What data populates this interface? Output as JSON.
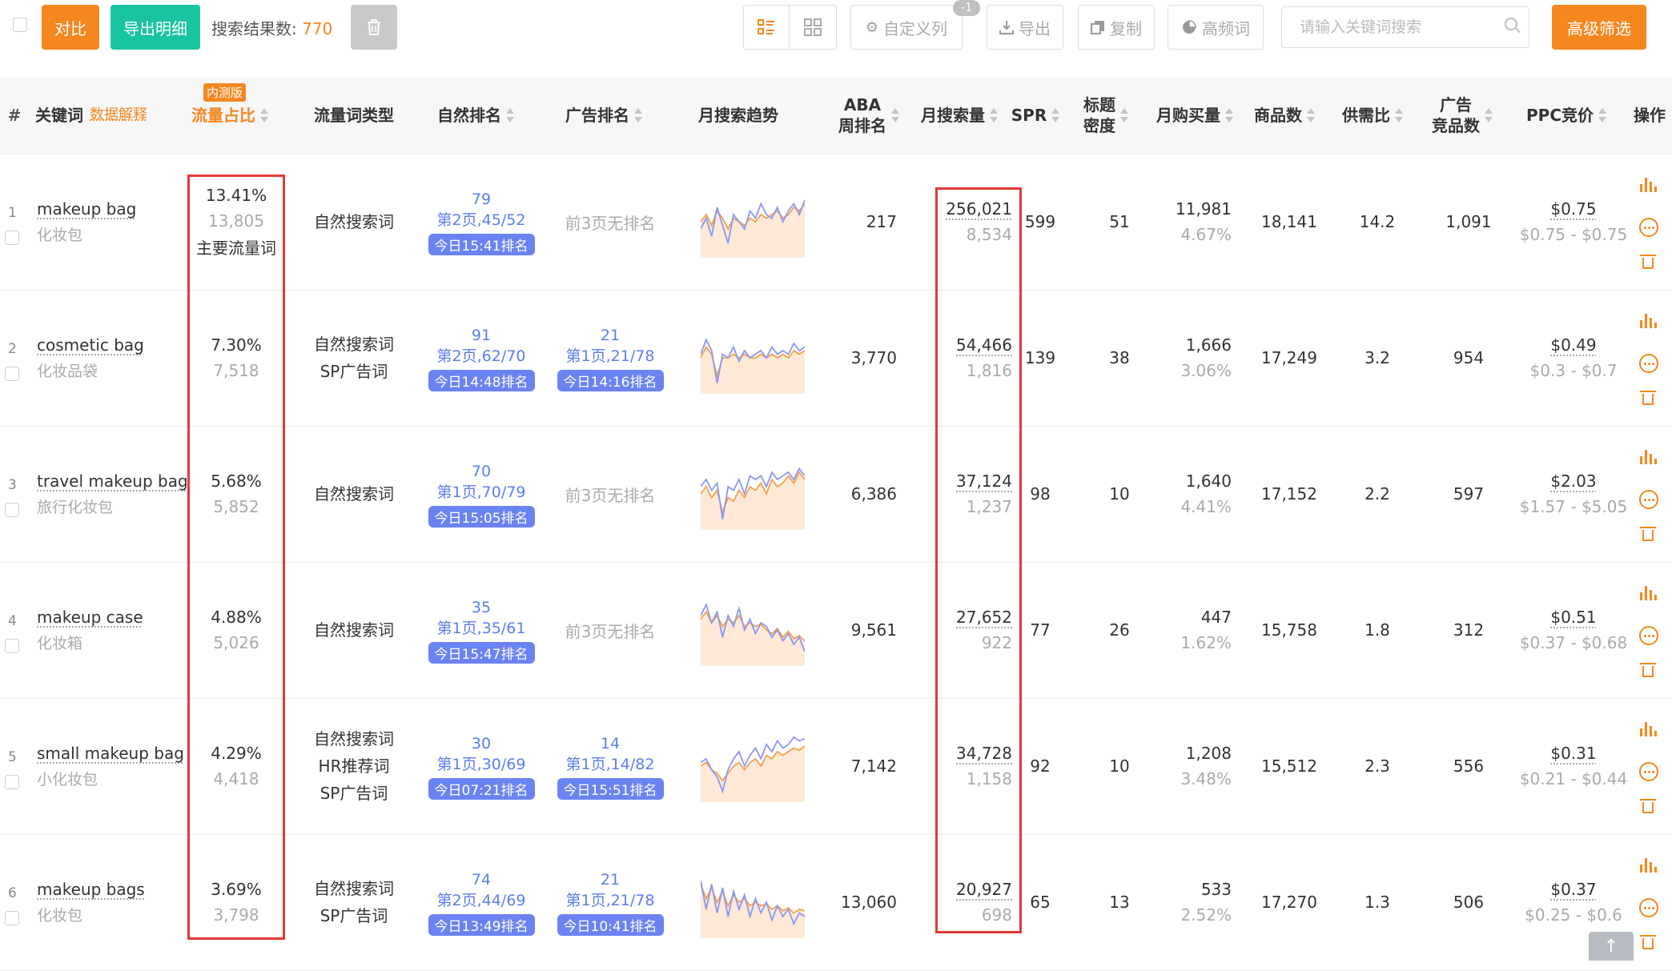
{
  "toolbar": {
    "compare_label": "对比",
    "export_detail_label": "导出明细",
    "result_label": "搜索结果数: ",
    "result_count": "770",
    "custom_columns_label": "自定义列",
    "custom_columns_badge": "-1",
    "export_label": "导出",
    "copy_label": "复制",
    "highfreq_label": "高频词",
    "search_placeholder": "请输入关键词搜索",
    "advanced_filter_label": "高级筛选"
  },
  "columns": {
    "index": "#",
    "keyword": "关键词",
    "keyword_help": "数据解释",
    "beta": "内测版",
    "traffic_share": "流量占比",
    "traffic_type": "流量词类型",
    "organic_rank": "自然排名",
    "ad_rank": "广告排名",
    "trend": "月搜索趋势",
    "aba_line1": "ABA",
    "aba_line2": "周排名",
    "monthly_search": "月搜索量",
    "spr": "SPR",
    "title_density_line1": "标题",
    "title_density_line2": "密度",
    "monthly_purchase": "月购买量",
    "product_count": "商品数",
    "supply_demand": "供需比",
    "ad_competitors_line1": "广告",
    "ad_competitors_line2": "竞品数",
    "ppc": "PPC竞价",
    "actions": "操作"
  },
  "rows": [
    {
      "num": "1",
      "kw_en": "makeup bag",
      "kw_cn": "化妆包",
      "share_pct": "13.41%",
      "share_num": "13,805",
      "share_tag": "主要流量词",
      "types": [
        "自然搜索词"
      ],
      "org_rank": "79",
      "org_page": "第2页,45/52",
      "org_time": "今日15:41排名",
      "ad_none": "前3页无排名",
      "aba": "217",
      "search": "256,021",
      "search_sub": "8,534",
      "spr": "599",
      "density": "51",
      "purchase": "11,981",
      "purchase_pct": "4.67%",
      "products": "18,141",
      "ratio": "14.2",
      "ad_comp": "1,091",
      "ppc": "$0.75",
      "ppc_range": "$0.75 - $0.75",
      "trend_blue": [
        40,
        55,
        30,
        70,
        45,
        20,
        60,
        50,
        40,
        65,
        55,
        75,
        60,
        55,
        70,
        50,
        65,
        75,
        60,
        80
      ],
      "trend_orange": [
        50,
        60,
        45,
        65,
        55,
        40,
        55,
        50,
        45,
        55,
        50,
        60,
        55,
        60,
        65,
        55,
        60,
        70,
        65,
        75
      ]
    },
    {
      "num": "2",
      "kw_en": "cosmetic bag",
      "kw_cn": "化妆品袋",
      "share_pct": "7.30%",
      "share_num": "7,518",
      "types": [
        "自然搜索词",
        "SP广告词"
      ],
      "org_rank": "91",
      "org_page": "第2页,62/70",
      "org_time": "今日14:48排名",
      "ad_rank": "21",
      "ad_page": "第1页,21/78",
      "ad_time": "今日14:16排名",
      "aba": "3,770",
      "search": "54,466",
      "search_sub": "1,816",
      "spr": "139",
      "density": "38",
      "purchase": "1,666",
      "purchase_pct": "3.06%",
      "products": "17,249",
      "ratio": "3.2",
      "ad_comp": "954",
      "ppc": "$0.49",
      "ppc_range": "$0.3 - $0.7",
      "trend_blue": [
        55,
        75,
        60,
        15,
        55,
        50,
        65,
        45,
        60,
        50,
        55,
        60,
        50,
        65,
        55,
        60,
        55,
        70,
        60,
        65
      ],
      "trend_orange": [
        50,
        65,
        55,
        25,
        50,
        50,
        55,
        50,
        55,
        50,
        50,
        55,
        50,
        55,
        50,
        55,
        50,
        60,
        55,
        60
      ]
    },
    {
      "num": "3",
      "kw_en": "travel makeup bag",
      "kw_cn": "旅行化妆包",
      "share_pct": "5.68%",
      "share_num": "5,852",
      "types": [
        "自然搜索词"
      ],
      "org_rank": "70",
      "org_page": "第1页,70/79",
      "org_time": "今日15:05排名",
      "ad_none": "前3页无排名",
      "aba": "6,386",
      "search": "37,124",
      "search_sub": "1,237",
      "spr": "98",
      "density": "10",
      "purchase": "1,640",
      "purchase_pct": "4.41%",
      "products": "17,152",
      "ratio": "2.2",
      "ad_comp": "597",
      "ppc": "$2.03",
      "ppc_range": "$1.57 - $5.05",
      "trend_blue": [
        60,
        70,
        55,
        65,
        15,
        60,
        55,
        70,
        50,
        75,
        70,
        75,
        60,
        80,
        70,
        75,
        80,
        70,
        85,
        75
      ],
      "trend_orange": [
        50,
        60,
        45,
        55,
        25,
        45,
        40,
        55,
        45,
        60,
        55,
        65,
        50,
        70,
        60,
        65,
        75,
        65,
        80,
        70
      ]
    },
    {
      "num": "4",
      "kw_en": "makeup case",
      "kw_cn": "化妆箱",
      "share_pct": "4.88%",
      "share_num": "5,026",
      "types": [
        "自然搜索词"
      ],
      "org_rank": "35",
      "org_page": "第1页,35/61",
      "org_time": "今日15:47排名",
      "ad_none": "前3页无排名",
      "aba": "9,561",
      "search": "27,652",
      "search_sub": "922",
      "spr": "77",
      "density": "26",
      "purchase": "447",
      "purchase_pct": "1.62%",
      "products": "15,758",
      "ratio": "1.8",
      "ad_comp": "312",
      "ppc": "$0.51",
      "ppc_range": "$0.37 - $0.68",
      "trend_blue": [
        70,
        85,
        60,
        75,
        40,
        70,
        55,
        80,
        50,
        65,
        45,
        60,
        55,
        40,
        50,
        35,
        45,
        30,
        40,
        20
      ],
      "trend_orange": [
        65,
        75,
        60,
        70,
        55,
        65,
        60,
        70,
        55,
        60,
        55,
        58,
        50,
        45,
        52,
        40,
        48,
        38,
        42,
        35
      ]
    },
    {
      "num": "5",
      "kw_en": "small makeup bag",
      "kw_cn": "小化妆包",
      "share_pct": "4.29%",
      "share_num": "4,418",
      "types": [
        "自然搜索词",
        "HR推荐词",
        "SP广告词"
      ],
      "org_rank": "30",
      "org_page": "第1页,30/69",
      "org_time": "今日07:21排名",
      "ad_rank": "14",
      "ad_page": "第1页,14/82",
      "ad_time": "今日15:51排名",
      "aba": "7,142",
      "search": "34,728",
      "search_sub": "1,158",
      "spr": "92",
      "density": "10",
      "purchase": "1,208",
      "purchase_pct": "3.48%",
      "products": "15,512",
      "ratio": "2.3",
      "ad_comp": "556",
      "ppc": "$0.31",
      "ppc_range": "$0.21 - $0.44",
      "trend_blue": [
        55,
        60,
        45,
        35,
        15,
        45,
        60,
        70,
        50,
        65,
        75,
        60,
        80,
        70,
        85,
        75,
        80,
        90,
        85,
        88
      ],
      "trend_orange": [
        50,
        55,
        45,
        40,
        30,
        40,
        50,
        55,
        45,
        55,
        60,
        50,
        65,
        60,
        70,
        65,
        70,
        75,
        72,
        78
      ]
    },
    {
      "num": "6",
      "kw_en": "makeup bags",
      "kw_cn": "化妆包",
      "share_pct": "3.69%",
      "share_num": "3,798",
      "types": [
        "自然搜索词",
        "SP广告词"
      ],
      "org_rank": "74",
      "org_page": "第2页,44/69",
      "org_time": "今日13:49排名",
      "ad_rank": "21",
      "ad_page": "第1页,21/78",
      "ad_time": "今日10:41排名",
      "aba": "13,060",
      "search": "20,927",
      "search_sub": "698",
      "spr": "65",
      "density": "13",
      "purchase": "533",
      "purchase_pct": "2.52%",
      "products": "17,270",
      "ratio": "1.3",
      "ad_comp": "506",
      "ppc": "$0.37",
      "ppc_range": "$0.25 - $0.6",
      "trend_blue": [
        80,
        40,
        75,
        35,
        70,
        30,
        65,
        40,
        60,
        30,
        55,
        35,
        50,
        25,
        45,
        30,
        40,
        20,
        35,
        30
      ],
      "trend_orange": [
        75,
        55,
        70,
        50,
        65,
        45,
        60,
        50,
        55,
        45,
        50,
        45,
        48,
        40,
        45,
        38,
        42,
        35,
        40,
        38
      ]
    }
  ],
  "colors": {
    "accent": "#f5871f",
    "green": "#18c59f",
    "blue": "#5b7ef0",
    "pill": "#6b83f2",
    "highlight": "#e53935",
    "trend_blue": "#8a97f5",
    "trend_orange": "#f5a04a"
  },
  "icons": [
    "list-view-icon",
    "grid-view-icon",
    "gear-icon",
    "download-icon",
    "copy-icon",
    "pie-chart-icon",
    "search-icon",
    "trash-icon",
    "bar-chart-icon",
    "more-icon",
    "arrow-up-icon"
  ]
}
